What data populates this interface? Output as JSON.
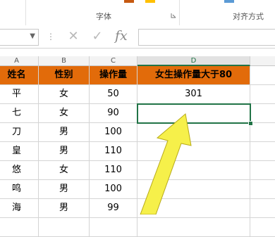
{
  "ribbon": {
    "group_font_label": "字体",
    "group_align_label": "对齐方式"
  },
  "formula_bar": {
    "cancel_glyph": "✕",
    "enter_glyph": "✓",
    "fx_label": "fx",
    "namebox_value": "",
    "formula_value": ""
  },
  "columns": [
    {
      "label": "A"
    },
    {
      "label": "B"
    },
    {
      "label": "C"
    },
    {
      "label": "D"
    }
  ],
  "table": {
    "headers": [
      "姓名",
      "性别",
      "操作量",
      "女生操作量大于80"
    ],
    "rows": [
      [
        "平",
        "女",
        "50",
        "301"
      ],
      [
        "七",
        "女",
        "90",
        ""
      ],
      [
        "刀",
        "男",
        "100",
        ""
      ],
      [
        "皇",
        "男",
        "110",
        ""
      ],
      [
        "悠",
        "女",
        "110",
        ""
      ],
      [
        "鸣",
        "男",
        "100",
        ""
      ],
      [
        "海",
        "男",
        "99",
        ""
      ]
    ]
  },
  "colors": {
    "header_fill": "#e26b0a",
    "selection": "#217346",
    "arrow": "#f6f04a"
  }
}
